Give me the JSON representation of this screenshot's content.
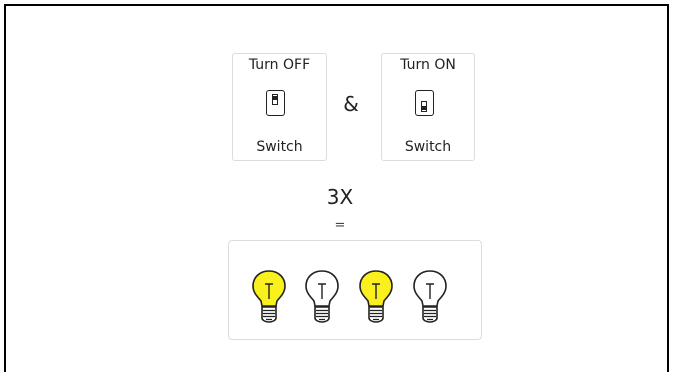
{
  "switches": {
    "off": {
      "title": "Turn OFF",
      "subtitle": "Switch"
    },
    "on": {
      "title": "Turn ON",
      "subtitle": "Switch"
    }
  },
  "connector": "&",
  "multiplier": "3X",
  "equals": "=",
  "bulbs": [
    {
      "state": "on"
    },
    {
      "state": "off"
    },
    {
      "state": "on"
    },
    {
      "state": "off"
    }
  ],
  "colors": {
    "bulb_on": "#f9f01e",
    "bulb_off": "#ffffff",
    "stroke": "#222222"
  }
}
